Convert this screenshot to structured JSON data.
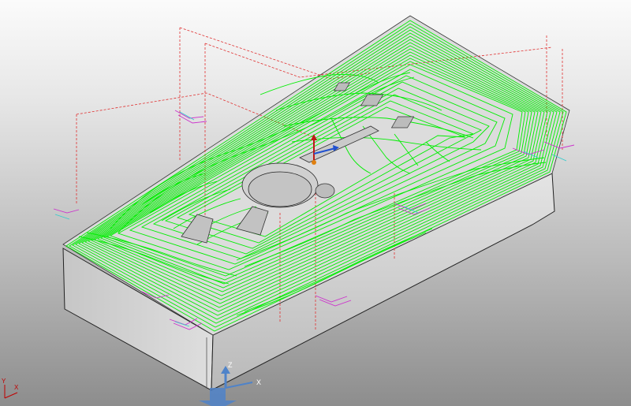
{
  "viewport": {
    "background_top": "#fbfbfb",
    "background_bottom": "#8d8d8d"
  },
  "toolpath": {
    "color": "#00ee00",
    "rapid_move_color": "#e03030",
    "lead_color": "#cc33cc",
    "link_color": "#33cccc"
  },
  "part": {
    "stock_side_color": "#d9d9d9",
    "stock_front_color": "#c8c8c8",
    "edge_color": "#222222"
  },
  "datum": {
    "z_label": "Z",
    "x_label": "X",
    "arrow_color": "#4f83c9"
  },
  "corner_triad": {
    "labels": [
      "Y",
      "X"
    ]
  },
  "work_origin": {
    "z_arrow_color": "#c01818",
    "x_arrow_color": "#2050d0",
    "origin_color": "#e08010"
  }
}
